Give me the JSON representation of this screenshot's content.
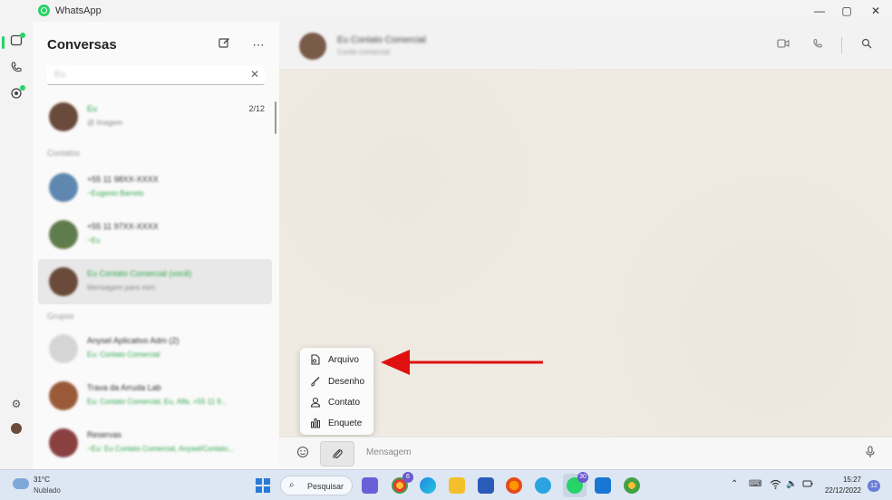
{
  "app": {
    "title": "WhatsApp"
  },
  "window_controls": {
    "minimize": "—",
    "maximize": "▢",
    "close": "✕"
  },
  "chatlist": {
    "title": "Conversas",
    "search_value": "Eu",
    "sections": {
      "contacts": "Contatos",
      "groups": "Grupos"
    },
    "chats": [
      {
        "name": "Eu",
        "preview": "@ Imagem",
        "date": "2/12",
        "name_green": true
      },
      {
        "name": "+55 11 98XX-XXXX",
        "preview": "~Eugenio Barreto",
        "name_green": false
      },
      {
        "name": "+55 11 97XX-XXXX",
        "preview": "~Eu",
        "name_green": false
      },
      {
        "name": "Eu Contato Comercial (você)",
        "preview": "Mensagem para mim",
        "name_green": true,
        "selected": true
      },
      {
        "name": "Anysel Aplicativo Adm (2)",
        "preview": "Eu: Contato Comercial",
        "name_green": false
      },
      {
        "name": "Trava da Arruda Lab",
        "preview": "Eu: Contato Comercial, Eu, Alfa, +55 11 9...",
        "name_green": false
      },
      {
        "name": "Reservas",
        "preview": "~Eu: Eu Contato Comercial, Anysel/Contato...",
        "name_green": false
      }
    ]
  },
  "chat": {
    "name": "Eu Contato Comercial",
    "subtitle": "Conta comercial"
  },
  "attach_menu": {
    "items": [
      {
        "label": "Arquivo",
        "icon": "file-icon"
      },
      {
        "label": "Desenho",
        "icon": "brush-icon"
      },
      {
        "label": "Contato",
        "icon": "person-icon"
      },
      {
        "label": "Enquete",
        "icon": "poll-icon"
      }
    ]
  },
  "compose": {
    "placeholder": "Mensagem"
  },
  "taskbar": {
    "weather_temp": "31°C",
    "weather_desc": "Nublado",
    "search_label": "Pesquisar",
    "chrome_badge": "6",
    "whatsapp_badge": "30",
    "time": "15:27",
    "date": "22/12/2022",
    "notifications": "12"
  },
  "colors": {
    "accent": "#25d366",
    "arrow": "#e01010",
    "taskbar": "#dde7f3"
  }
}
